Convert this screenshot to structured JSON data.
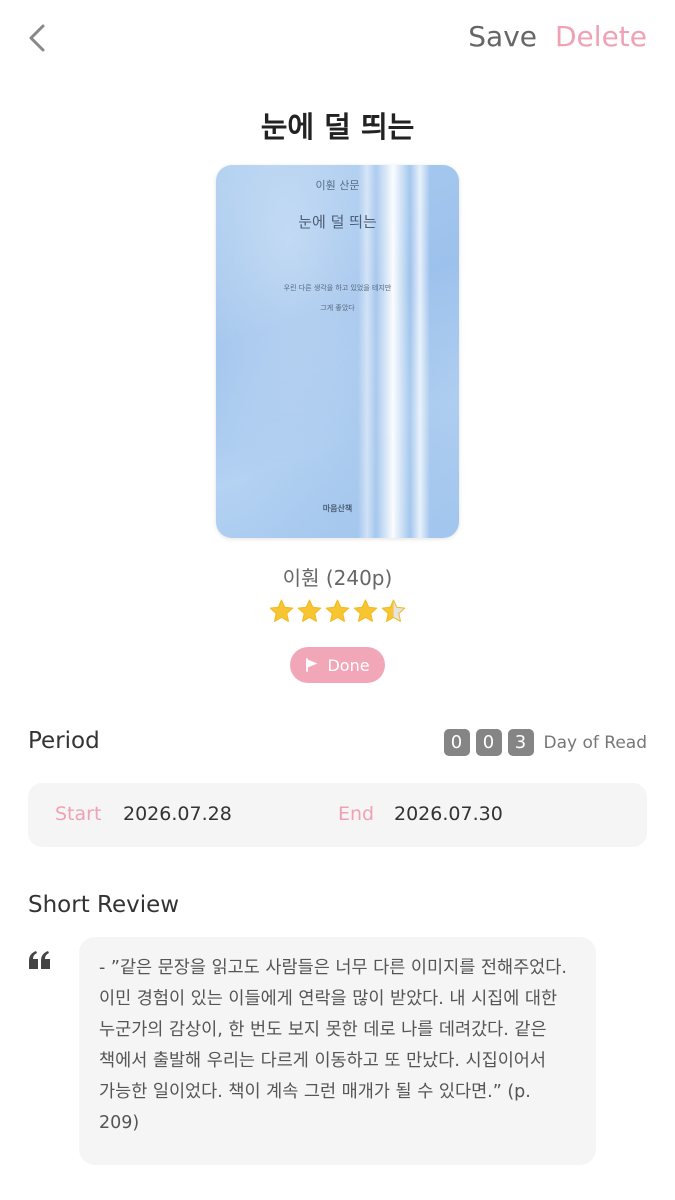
{
  "header": {
    "save_label": "Save",
    "delete_label": "Delete",
    "accent_color": "#f0a2b5"
  },
  "book": {
    "title": "눈에 덜 띄는",
    "author_pages": "이훤 (240p)",
    "rating": 4.5,
    "rating_max": 5,
    "status": "Done",
    "cover": {
      "author": "이훤 산문",
      "title": "눈에 덜 띄는",
      "subtitle_line1": "우린 다른 생각을 하고 있었을 테지만",
      "subtitle_line2": "그게 좋았다",
      "publisher": "마음산책"
    }
  },
  "period": {
    "label": "Period",
    "digits": [
      "0",
      "0",
      "3"
    ],
    "day_label": "Day of Read",
    "start_label": "Start",
    "start_date": "2026.07.28",
    "end_label": "End",
    "end_date": "2026.07.30"
  },
  "review": {
    "label": "Short Review",
    "text": "- ”같은 문장을 읽고도 사람들은 너무 다른 이미지를 전해주었다. 이민 경험이 있는 이들에게 연락을 많이 받았다. 내 시집에 대한 누군가의 감상이, 한 번도 보지 못한 데로 나를 데려갔다. 같은 책에서 출발해 우리는 다르게 이동하고 또 만났다. 시집이어서 가능한 일이었다. 책이 계속 그런 매개가 될 수 있다면.” (p. 209)"
  }
}
